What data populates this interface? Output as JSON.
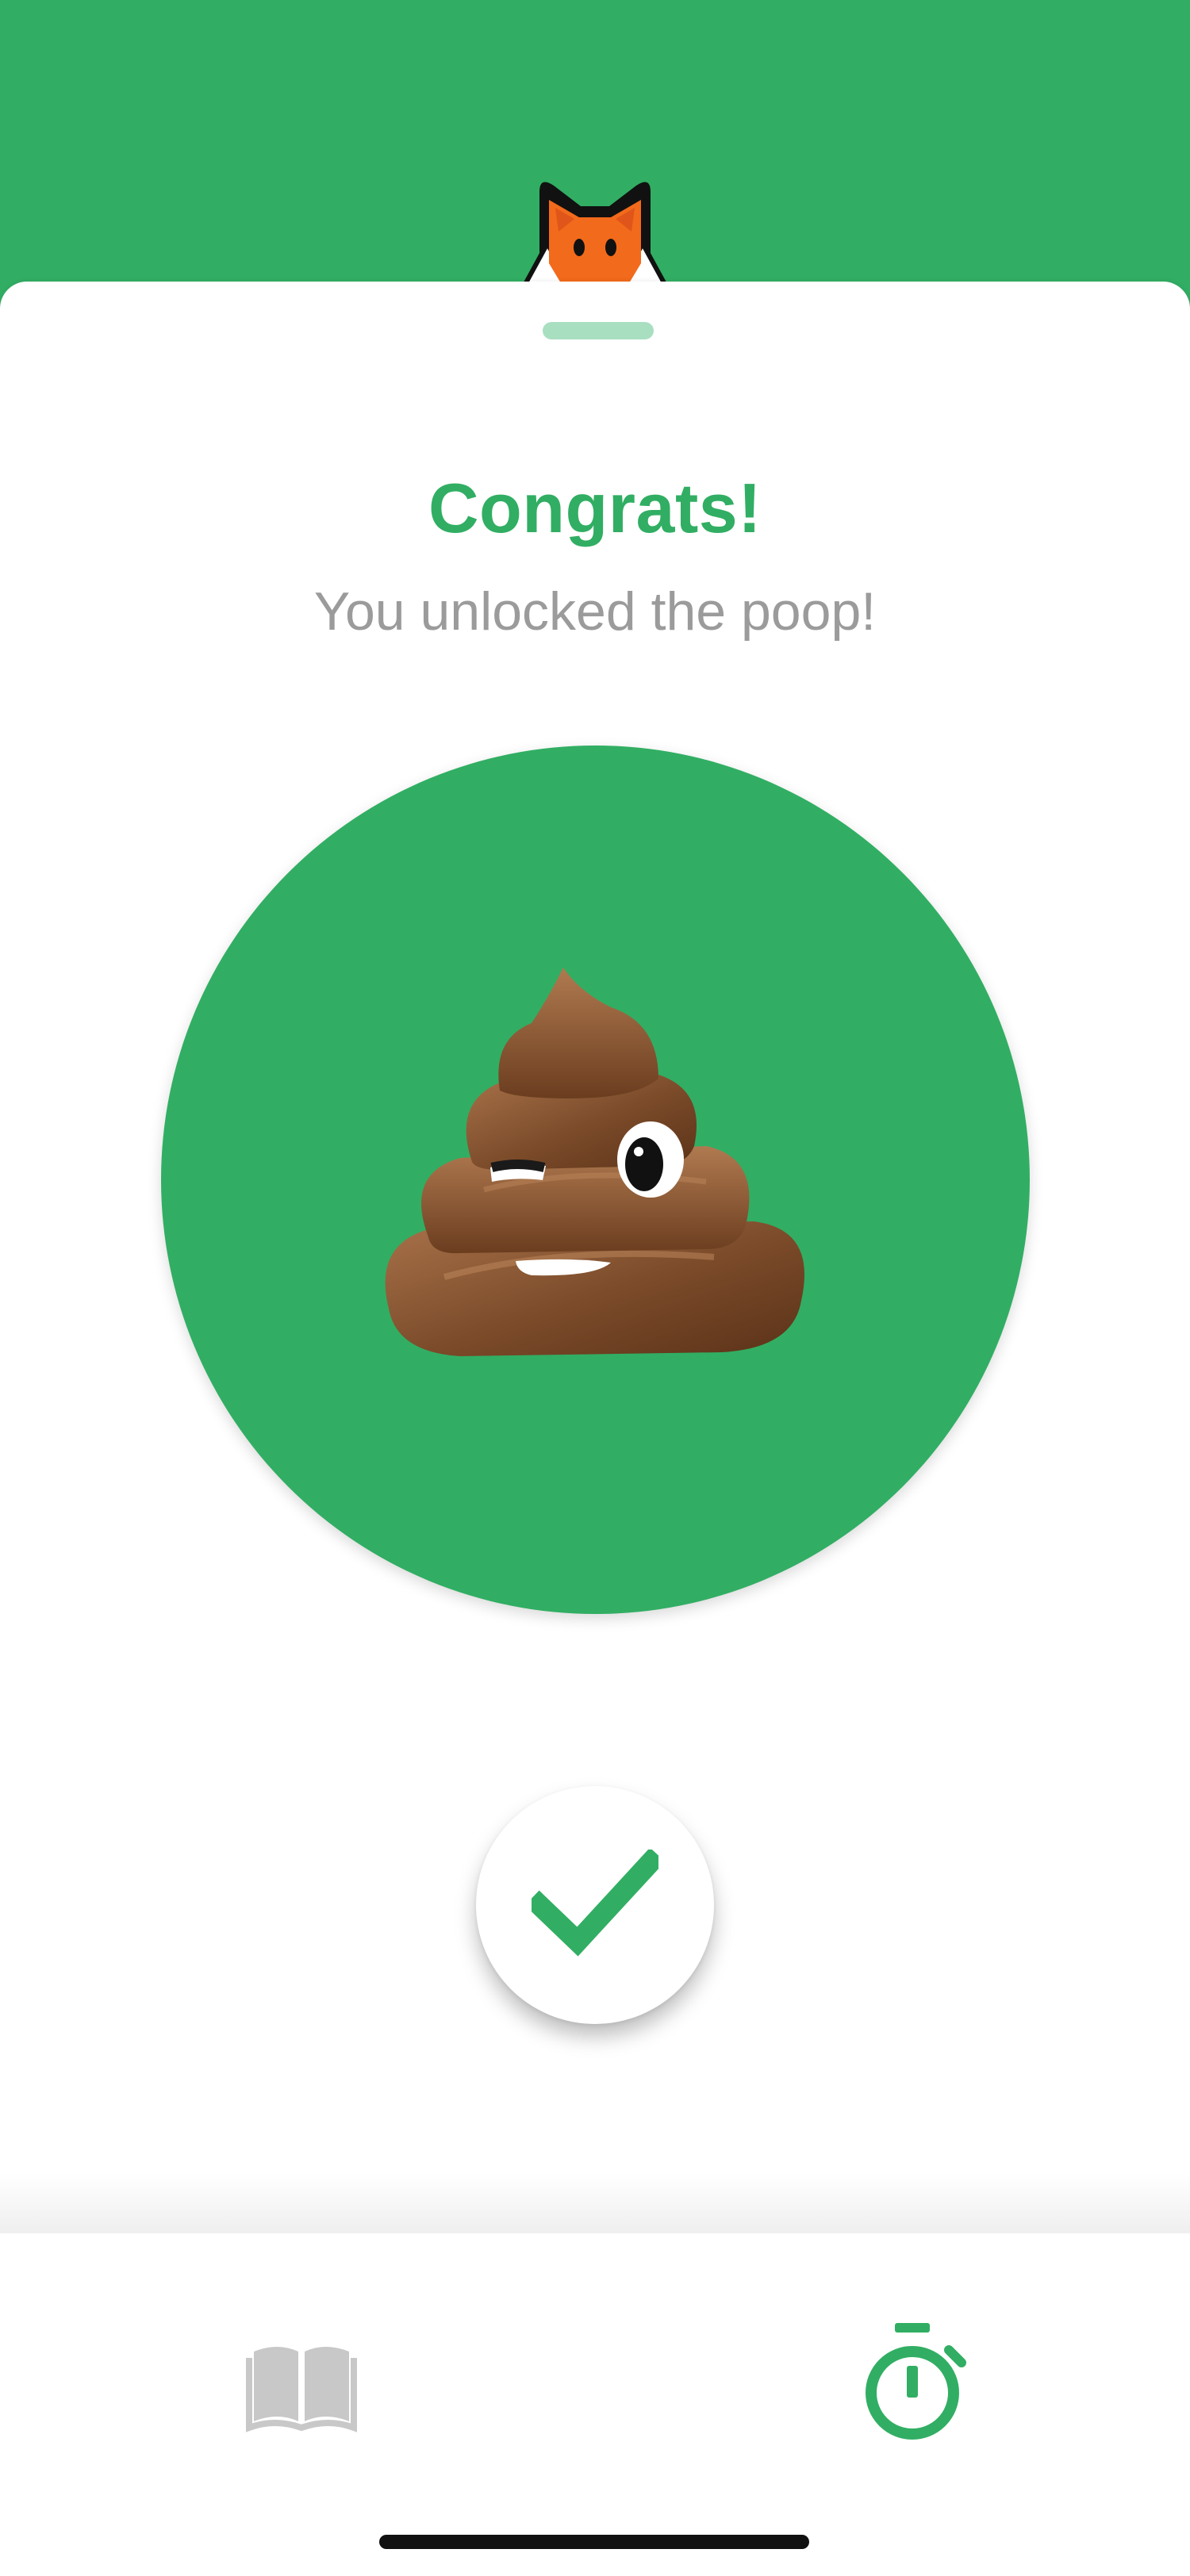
{
  "header": {
    "mascot_icon": "fox-mascot-icon",
    "banner_color": "#31ae63"
  },
  "reward": {
    "title": "Congrats!",
    "subtitle": "You unlocked the poop!",
    "reward_icon": "pile-of-poo-icon",
    "circle_color": "#31ae63"
  },
  "actions": {
    "confirm_icon": "checkmark-icon"
  },
  "tabbar": {
    "items": [
      {
        "icon": "book-icon",
        "active": false
      },
      {
        "icon": "stopwatch-icon",
        "active": true
      }
    ],
    "active_color": "#31ae63",
    "inactive_color": "#c8c8c8"
  }
}
